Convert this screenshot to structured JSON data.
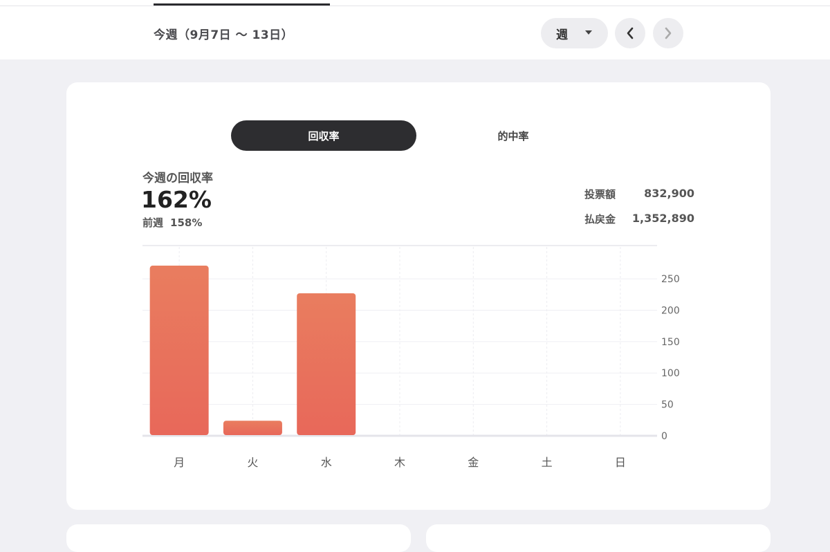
{
  "header": {
    "period_label": "今週（9月7日 〜 13日）",
    "period_select": "週"
  },
  "toggle": {
    "active_label": "回収率",
    "inactive_label": "的中率"
  },
  "summary": {
    "metric_label": "今週の回収率",
    "metric_value": "162%",
    "prev_label": "前週",
    "prev_value": "158%",
    "bet_label": "投票額",
    "bet_value": "832,900",
    "payout_label": "払戻金",
    "payout_value": "1,352,890"
  },
  "colors": {
    "bar_top": "#e97d5f",
    "bar_bottom": "#e8685a",
    "active_toggle": "#2d2d30"
  },
  "chart_data": {
    "type": "bar",
    "categories": [
      "月",
      "火",
      "水",
      "木",
      "金",
      "土",
      "日"
    ],
    "values": [
      271,
      24,
      227,
      0,
      0,
      0,
      0
    ],
    "ylim": [
      0,
      250
    ],
    "yticks": [
      0,
      50,
      100,
      150,
      200,
      250
    ],
    "grid": true,
    "y_axis_side": "right"
  }
}
